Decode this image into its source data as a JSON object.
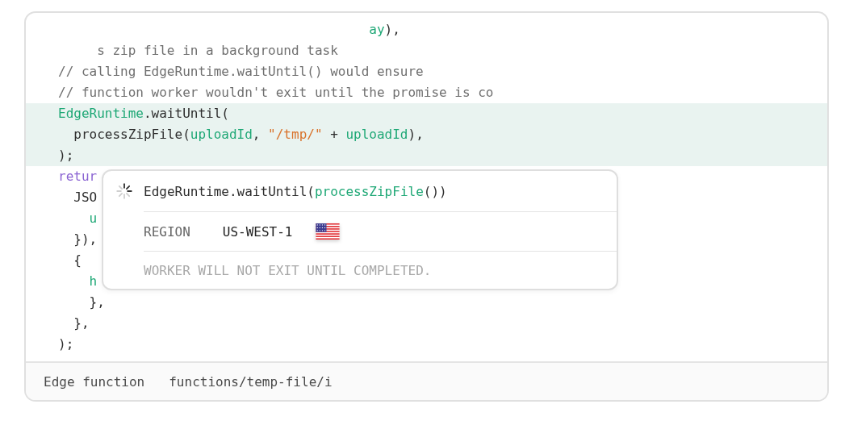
{
  "editor": {
    "lines": [
      {
        "highlighted": false,
        "tokens": [
          {
            "kind": "ident",
            "text": "                                        ay"
          },
          {
            "kind": "plain",
            "text": "),"
          }
        ]
      },
      {
        "highlighted": false,
        "tokens": [
          {
            "kind": "comment",
            "text": "     s zip file in a background task"
          }
        ]
      },
      {
        "highlighted": false,
        "tokens": [
          {
            "kind": "comment",
            "text": "// calling EdgeRuntime.waitUntil() would ensure"
          }
        ]
      },
      {
        "highlighted": false,
        "tokens": [
          {
            "kind": "comment",
            "text": "// function worker wouldn't exit until the promise is co"
          }
        ]
      },
      {
        "highlighted": true,
        "tokens": [
          {
            "kind": "ident",
            "text": "EdgeRuntime"
          },
          {
            "kind": "plain",
            "text": ".waitUntil("
          }
        ]
      },
      {
        "highlighted": true,
        "tokens": [
          {
            "kind": "plain",
            "text": "  processZipFile("
          },
          {
            "kind": "ident",
            "text": "uploadId"
          },
          {
            "kind": "plain",
            "text": ", "
          },
          {
            "kind": "string",
            "text": "\"/tmp/\""
          },
          {
            "kind": "plain",
            "text": " + "
          },
          {
            "kind": "ident",
            "text": "uploadId"
          },
          {
            "kind": "plain",
            "text": "),"
          }
        ]
      },
      {
        "highlighted": true,
        "tokens": [
          {
            "kind": "plain",
            "text": ");"
          }
        ]
      },
      {
        "highlighted": false,
        "tokens": [
          {
            "kind": "keyword",
            "text": "retur"
          }
        ]
      },
      {
        "highlighted": false,
        "tokens": [
          {
            "kind": "plain",
            "text": "  JSO"
          }
        ]
      },
      {
        "highlighted": false,
        "tokens": [
          {
            "kind": "ident",
            "text": "    u"
          }
        ]
      },
      {
        "highlighted": false,
        "tokens": [
          {
            "kind": "plain",
            "text": "  }),"
          }
        ]
      },
      {
        "highlighted": false,
        "tokens": [
          {
            "kind": "plain",
            "text": "  {"
          }
        ]
      },
      {
        "highlighted": false,
        "tokens": [
          {
            "kind": "ident",
            "text": "    h"
          }
        ]
      },
      {
        "highlighted": false,
        "tokens": [
          {
            "kind": "plain",
            "text": "    },"
          }
        ]
      },
      {
        "highlighted": false,
        "tokens": [
          {
            "kind": "plain",
            "text": "  },"
          }
        ]
      },
      {
        "highlighted": false,
        "tokens": [
          {
            "kind": "plain",
            "text": ");"
          }
        ]
      }
    ]
  },
  "popover": {
    "call": [
      {
        "kind": "plain",
        "text": "EdgeRuntime.waitUntil("
      },
      {
        "kind": "ident",
        "text": "processZipFile"
      },
      {
        "kind": "plain",
        "text": "())"
      }
    ],
    "region_label": "REGION",
    "region_value": "US-WEST-1",
    "note": "WORKER WILL NOT EXIT UNTIL COMPLETED."
  },
  "footer": {
    "label": "Edge function",
    "path": "functions/temp-file/i"
  }
}
